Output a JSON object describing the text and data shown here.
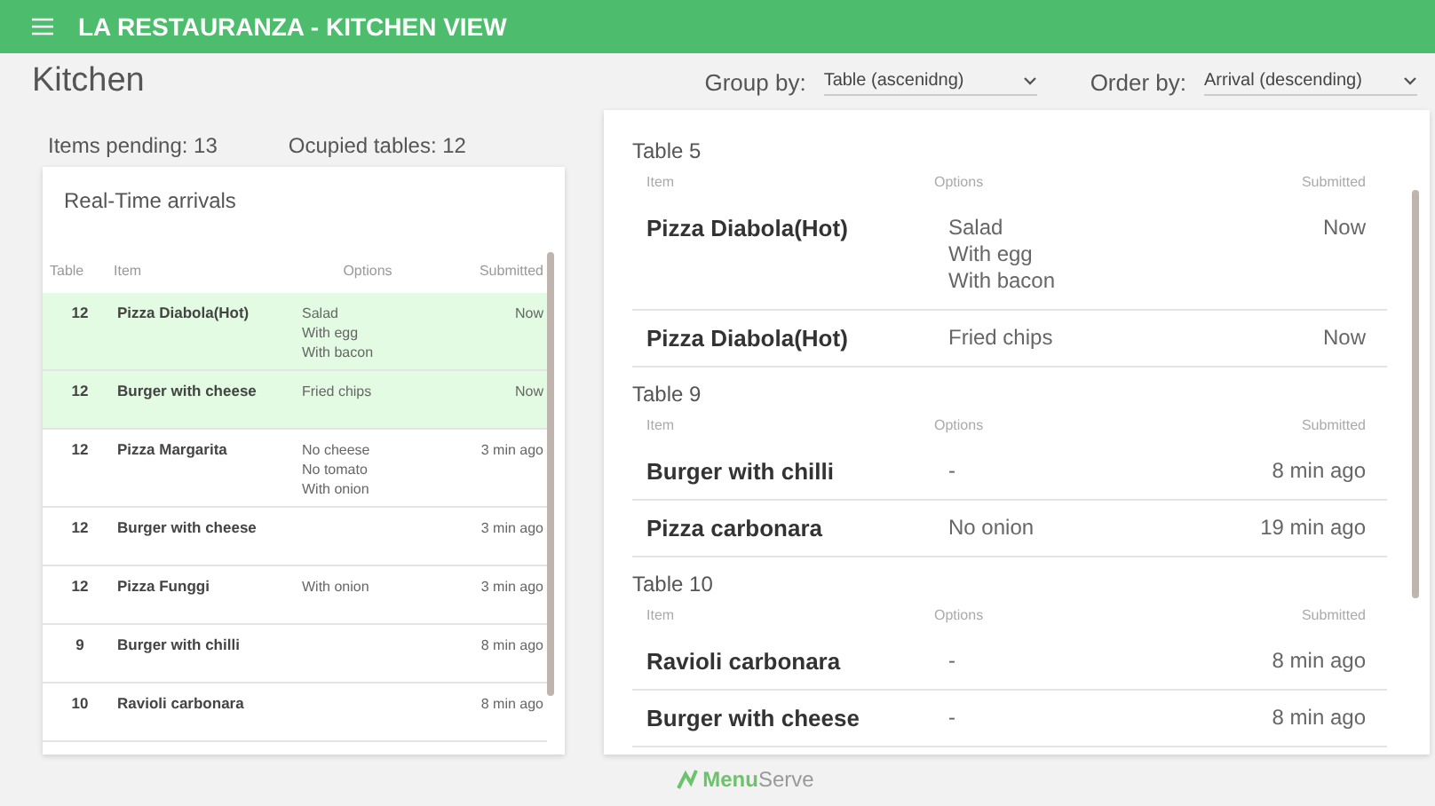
{
  "app_bar": {
    "title": "LA RESTAURANZA  - KITCHEN VIEW"
  },
  "page_title": "Kitchen",
  "group_by": {
    "label": "Group by:",
    "value": "Table (ascenidng)"
  },
  "order_by": {
    "label": "Order by:",
    "value": "Arrival (descending)"
  },
  "stats": [
    "Items pending: 13",
    "Ocupied tables: 12"
  ],
  "arrivals": {
    "title": "Real-Time arrivals",
    "columns": [
      "Table",
      "Item",
      "Options",
      "Submitted"
    ],
    "rows": [
      {
        "table": "12",
        "item": "Pizza Diabola(Hot)",
        "options": [
          "Salad",
          "With egg",
          "With bacon"
        ],
        "submitted": "Now",
        "is_new": true
      },
      {
        "table": "12",
        "item": "Burger with cheese",
        "options": [
          "Fried chips"
        ],
        "submitted": "Now",
        "is_new": true
      },
      {
        "table": "12",
        "item": "Pizza Margarita",
        "options": [
          "No cheese",
          "No tomato",
          "With onion"
        ],
        "submitted": "3 min ago",
        "is_new": false
      },
      {
        "table": "12",
        "item": "Burger with cheese",
        "options": [],
        "submitted": "3 min ago",
        "is_new": false
      },
      {
        "table": "12",
        "item": "Pizza Funggi",
        "options": [
          "With onion"
        ],
        "submitted": "3 min ago",
        "is_new": false
      },
      {
        "table": "9",
        "item": "Burger with chilli",
        "options": [],
        "submitted": "8 min ago",
        "is_new": false
      },
      {
        "table": "10",
        "item": "Ravioli carbonara",
        "options": [],
        "submitted": "8 min ago",
        "is_new": false
      }
    ]
  },
  "groups": [
    {
      "title": "Table 5",
      "columns": [
        "Item",
        "Options",
        "Submitted"
      ],
      "rows": [
        {
          "item": "Pizza Diabola(Hot)",
          "options": [
            "Salad",
            "With egg",
            "With bacon"
          ],
          "submitted": "Now"
        },
        {
          "item": "Pizza Diabola(Hot)",
          "options": [
            "Fried chips"
          ],
          "submitted": "Now"
        }
      ]
    },
    {
      "title": "Table 9",
      "columns": [
        "Item",
        "Options",
        "Submitted"
      ],
      "rows": [
        {
          "item": "Burger with chilli",
          "options": [
            "-"
          ],
          "submitted": "8 min ago"
        },
        {
          "item": "Pizza carbonara",
          "options": [
            "No onion"
          ],
          "submitted": "19 min ago"
        }
      ]
    },
    {
      "title": "Table 10",
      "columns": [
        "Item",
        "Options",
        "Submitted"
      ],
      "rows": [
        {
          "item": "Ravioli carbonara",
          "options": [
            "-"
          ],
          "submitted": "8 min ago"
        },
        {
          "item": "Burger with cheese",
          "options": [
            "-"
          ],
          "submitted": "8 min ago"
        }
      ]
    }
  ],
  "footer_logo": {
    "first": "Menu",
    "second": "Serve"
  }
}
